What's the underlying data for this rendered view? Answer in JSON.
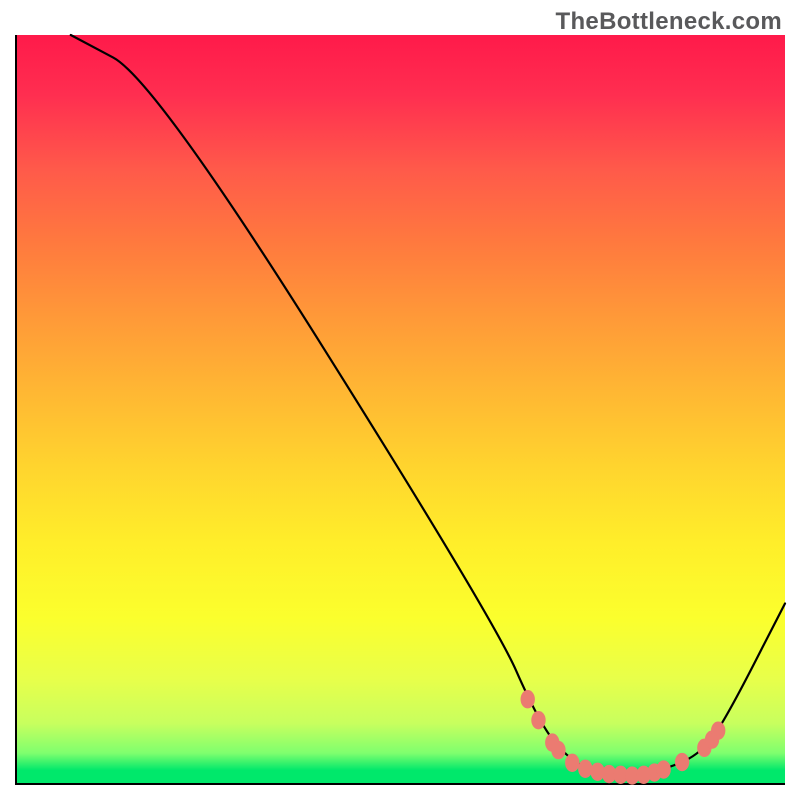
{
  "watermark": "TheBottleneck.com",
  "chart_data": {
    "type": "line",
    "title": "",
    "xlabel": "",
    "ylabel": "",
    "xlim": [
      0,
      100
    ],
    "ylim": [
      0,
      100
    ],
    "curve": [
      {
        "x": 7,
        "y": 100
      },
      {
        "x": 18,
        "y": 94
      },
      {
        "x": 62,
        "y": 22
      },
      {
        "x": 68,
        "y": 8
      },
      {
        "x": 72,
        "y": 3
      },
      {
        "x": 76,
        "y": 1.2
      },
      {
        "x": 80,
        "y": 1
      },
      {
        "x": 85,
        "y": 2
      },
      {
        "x": 89,
        "y": 4
      },
      {
        "x": 92,
        "y": 8
      },
      {
        "x": 100,
        "y": 24
      }
    ],
    "markers": [
      {
        "x": 66.5,
        "y": 11.2
      },
      {
        "x": 67.9,
        "y": 8.4
      },
      {
        "x": 69.7,
        "y": 5.4
      },
      {
        "x": 70.5,
        "y": 4.4
      },
      {
        "x": 72.3,
        "y": 2.7
      },
      {
        "x": 74.0,
        "y": 1.9
      },
      {
        "x": 75.6,
        "y": 1.5
      },
      {
        "x": 77.1,
        "y": 1.2
      },
      {
        "x": 78.6,
        "y": 1.1
      },
      {
        "x": 80.1,
        "y": 1.0
      },
      {
        "x": 81.6,
        "y": 1.1
      },
      {
        "x": 83.0,
        "y": 1.4
      },
      {
        "x": 84.2,
        "y": 1.8
      },
      {
        "x": 86.6,
        "y": 2.8
      },
      {
        "x": 89.5,
        "y": 4.7
      },
      {
        "x": 90.5,
        "y": 5.8
      },
      {
        "x": 91.3,
        "y": 7.0
      }
    ],
    "background_gradient": {
      "top": "#ff1a4a",
      "upper_mid": "#ffb833",
      "lower_mid": "#fbff2d",
      "bottom": "#00e86b"
    },
    "colors": {
      "curve": "#000000",
      "markers": "#eb7b71"
    }
  }
}
